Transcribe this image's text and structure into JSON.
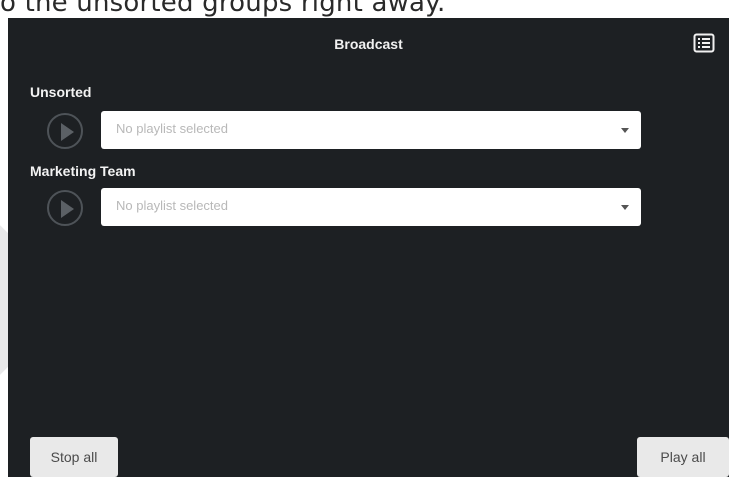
{
  "page": {
    "top_caption": "o the unsorted groups right away."
  },
  "header": {
    "title": "Broadcast",
    "icon_name": "list-view-icon"
  },
  "groups": [
    {
      "label": "Unsorted",
      "select_text": "No playlist selected",
      "play_icon_name": "play-icon",
      "caret_icon_name": "chevron-down-icon"
    },
    {
      "label": "Marketing Team",
      "select_text": "No playlist selected",
      "play_icon_name": "play-icon",
      "caret_icon_name": "chevron-down-icon"
    }
  ],
  "footer": {
    "stop_all_label": "Stop all",
    "play_all_label": "Play all"
  },
  "colors": {
    "panel_bg": "#1d2023",
    "panel_text": "#f1f1f1",
    "input_bg": "#ffffff",
    "input_placeholder": "#b8b8b8",
    "button_bg": "#e9e9e9",
    "button_text": "#4b4b4b",
    "play_icon": "#5b6065",
    "page_bg": "#ffffff"
  }
}
